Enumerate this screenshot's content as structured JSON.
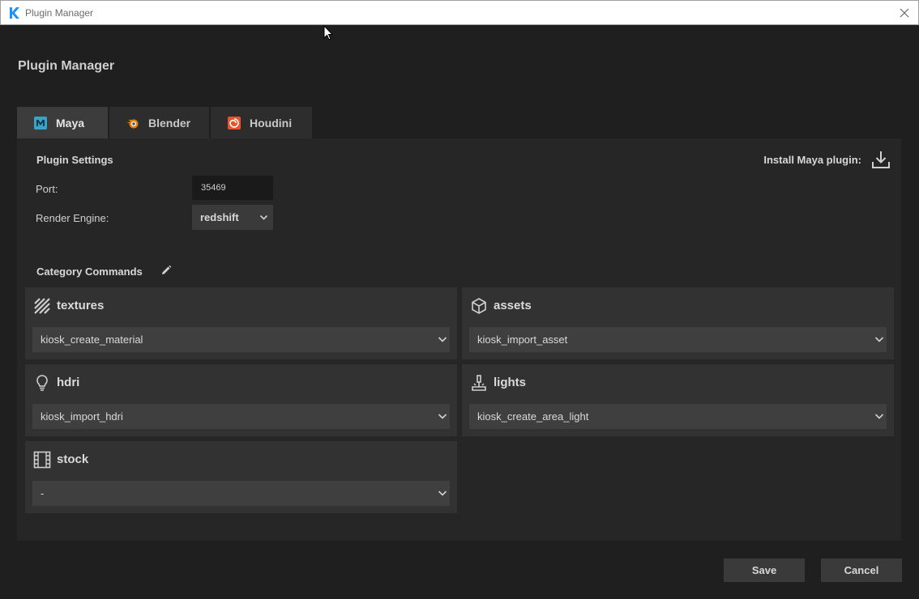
{
  "window": {
    "title": "Plugin Manager"
  },
  "page_title": "Plugin Manager",
  "tabs": [
    {
      "label": "Maya",
      "icon": "maya-icon",
      "active": true
    },
    {
      "label": "Blender",
      "icon": "blender-icon",
      "active": false
    },
    {
      "label": "Houdini",
      "icon": "houdini-icon",
      "active": false
    }
  ],
  "settings": {
    "heading": "Plugin Settings",
    "port_label": "Port:",
    "port_value": "35469",
    "engine_label": "Render Engine:",
    "engine_value": "redshift",
    "install_label": "Install Maya plugin:"
  },
  "category_commands": {
    "heading": "Category Commands",
    "categories": [
      {
        "title": "textures",
        "icon": "textures-icon",
        "command": "kiosk_create_material"
      },
      {
        "title": "assets",
        "icon": "cube-icon",
        "command": "kiosk_import_asset"
      },
      {
        "title": "hdri",
        "icon": "lightbulb-icon",
        "command": "kiosk_import_hdri"
      },
      {
        "title": "lights",
        "icon": "light-stand-icon",
        "command": "kiosk_create_area_light"
      },
      {
        "title": "stock",
        "icon": "film-icon",
        "command": "-"
      }
    ]
  },
  "footer": {
    "save_label": "Save",
    "cancel_label": "Cancel"
  },
  "colors": {
    "background": "#1f1f1f",
    "panel": "#262626",
    "card": "#323232",
    "accent": "#1e90ff"
  }
}
